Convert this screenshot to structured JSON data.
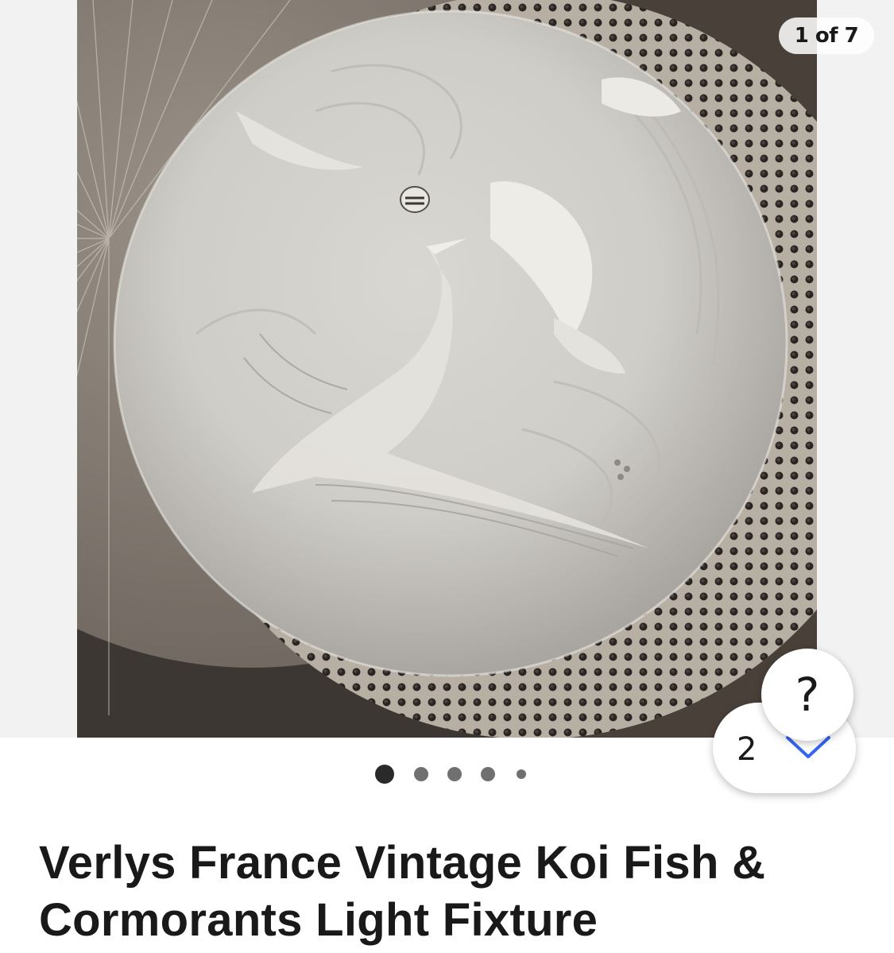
{
  "gallery": {
    "counter": "1 of 7",
    "photo_alt": "Verlys France Vintage Koi Fish & Cormorants Light Fixture",
    "dots": {
      "total": 5,
      "active_index": 0
    }
  },
  "floating": {
    "help_label": "?",
    "count_label": "2",
    "count_icon": "chevron-down-icon",
    "accent_color": "#3665f3"
  },
  "listing": {
    "title": "Verlys France Vintage Koi Fish & Cormorants Light Fixture"
  }
}
